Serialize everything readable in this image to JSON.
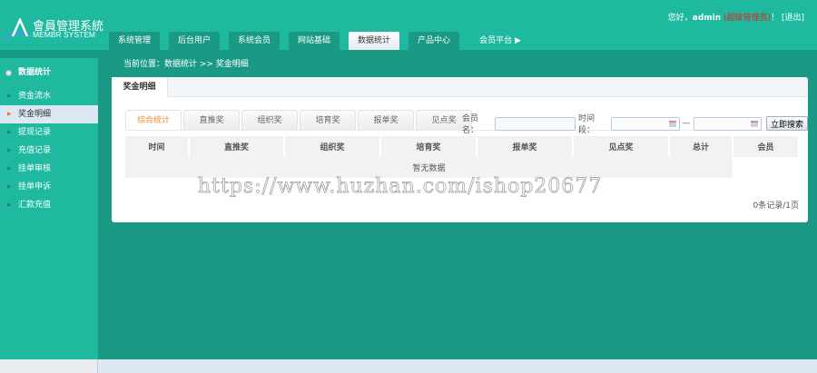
{
  "header": {
    "logo_cn": "會員管理系統",
    "logo_en": "MEMBR SYSTEM",
    "greeting": "您好，",
    "user": "admin",
    "role": "(超级管理员)",
    "exclaim": "！",
    "logout": "[退出]"
  },
  "nav": [
    "系统管理",
    "后台用户",
    "系统会员",
    "网站基础",
    "数据统计",
    "产品中心",
    "会员平台"
  ],
  "nav_active": 4,
  "sidebar": {
    "title": "数据统计",
    "items": [
      "资金流水",
      "奖金明细",
      "提现记录",
      "充值记录",
      "挂单审核",
      "挂单申诉",
      "汇款充值"
    ],
    "active": 1
  },
  "breadcrumb": "当前位置：数据统计 >> 奖金明细",
  "panel_tab": "奖金明细",
  "subtabs": [
    "综合统计",
    "直推奖",
    "组织奖",
    "培育奖",
    "报单奖",
    "见点奖"
  ],
  "search": {
    "member_label": "会员名：",
    "member_value": "",
    "period_label": "时间段：",
    "from": "",
    "to": "",
    "sep": "—",
    "button": "立即搜索"
  },
  "table": {
    "headers": [
      "时间",
      "直推奖",
      "组织奖",
      "培育奖",
      "报单奖",
      "见点奖",
      "总计",
      "会员"
    ],
    "empty": "暂无数据"
  },
  "pager": "0条记录/1页",
  "watermark": "https://www.huzhan.com/ishop20677",
  "colors": {
    "header": "#1fb9a0",
    "body": "#1a9985",
    "accent": "#f08a30",
    "role": "#e8201a"
  }
}
